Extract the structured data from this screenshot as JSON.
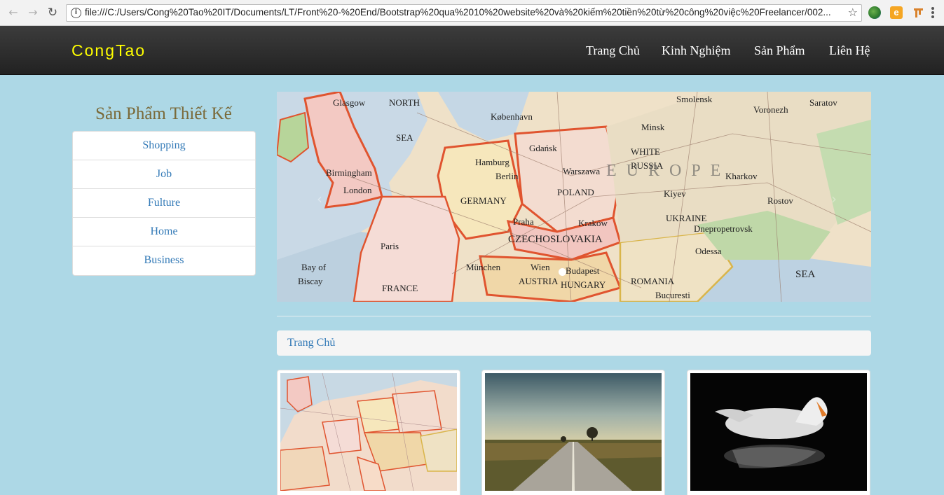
{
  "browser": {
    "url": "file:///C:/Users/Cong%20Tao%20IT/Documents/LT/Front%20-%20End/Bootstrap%20qua%2010%20website%20và%20kiếm%20tiền%20từ%20công%20việc%20Freelancer/002...",
    "back_icon": "arrow-left-icon",
    "forward_icon": "arrow-right-icon",
    "reload_icon": "reload-icon",
    "ext2_label": "e"
  },
  "navbar": {
    "brand": "CongTao",
    "brand_color": "#ffff00",
    "links": [
      "Trang Chủ",
      "Kinh Nghiệm",
      "Sản Phẩm",
      "Liên Hệ"
    ]
  },
  "sidebar": {
    "title": "Sản Phẩm Thiết Kế",
    "items": [
      "Shopping",
      "Job",
      "Fulture",
      "Home",
      "Business"
    ]
  },
  "carousel": {
    "map_labels": [
      "NORTH",
      "SEA",
      "København",
      "Glasgow",
      "Hamburg",
      "Berlin",
      "Gdańsk",
      "Minsk",
      "WHITE",
      "RUSSIA",
      "Smolensk",
      "Voronezh",
      "Saratov",
      "Birmingham",
      "London",
      "GERMANY",
      "POLAND",
      "Warszawa",
      "Kiyev",
      "Kharkov",
      "Paris",
      "Praha",
      "Kraków",
      "UKRAINE",
      "Dnepropetrovsk",
      "Rostov",
      "Bay of",
      "Biscay",
      "FRANCE",
      "München",
      "Wien",
      "Budapest",
      "AUSTRIA",
      "HUNGARY",
      "ROMANIA",
      "Odessa",
      "Bucuresti",
      "CZECHOSLOVAKIA",
      "EUROPE",
      "SEA"
    ]
  },
  "breadcrumb": {
    "label": "Trang Chủ"
  },
  "thumbnails": [
    "map-europe-image",
    "road-image",
    "swan-image"
  ]
}
